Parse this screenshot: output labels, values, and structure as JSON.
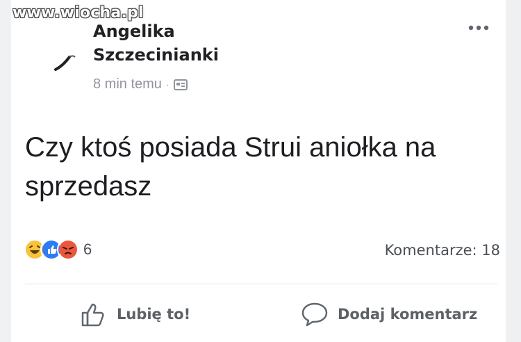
{
  "watermark": "www.wiocha.pl",
  "post": {
    "author_line1": "Angelika",
    "author_line2": "Szczecinianki",
    "time": "8 min temu",
    "meta_dot": "·",
    "text": "Czy ktoś posiada  Strui aniołka na sprzedasz",
    "reactions": {
      "icons": [
        "haha-icon",
        "like-icon",
        "angry-icon"
      ],
      "count": "6"
    },
    "comments": "Komentarze: 18"
  },
  "actions": {
    "like_label": "Lubię to!",
    "comment_label": "Dodaj komentarz"
  },
  "colors": {
    "haha": "#f7c33d",
    "like": "#2d7cf6",
    "angry": "#e9573f",
    "muted": "#90949c"
  }
}
